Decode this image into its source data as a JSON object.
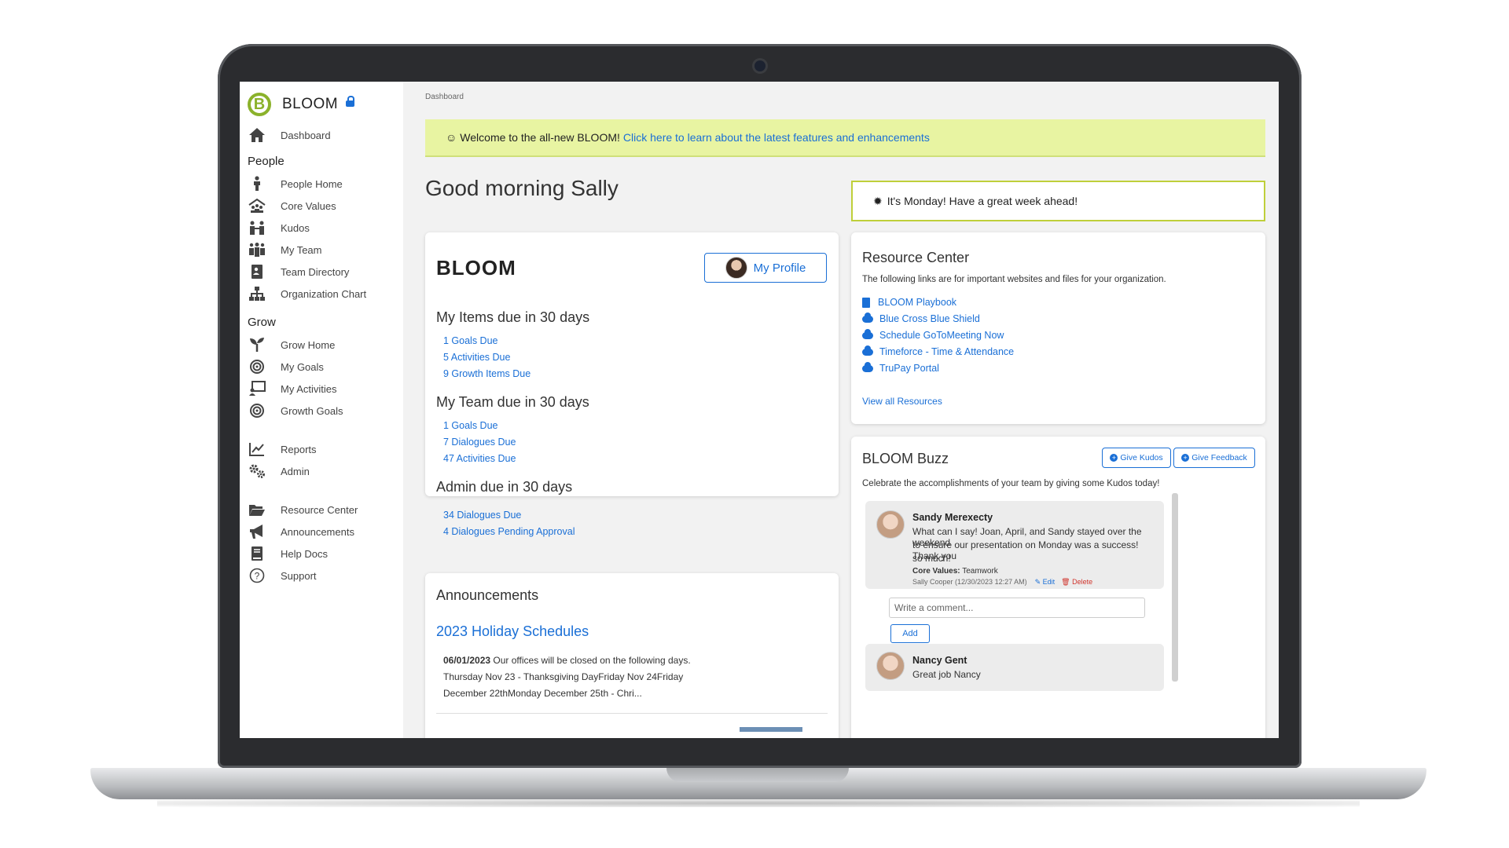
{
  "sidebar": {
    "brand": "BLOOM",
    "brand_logo_letter": "B",
    "dashboard": "Dashboard",
    "sections": {
      "people": "People",
      "grow": "Grow"
    },
    "people_items": [
      "People Home",
      "Core Values",
      "Kudos",
      "My Team",
      "Team Directory",
      "Organization Chart"
    ],
    "grow_items": [
      "Grow Home",
      "My Goals",
      "My Activities",
      "Growth Goals"
    ],
    "other_items": [
      "Reports",
      "Admin"
    ],
    "resource_items": [
      "Resource Center",
      "Announcements",
      "Help Docs",
      "Support"
    ]
  },
  "breadcrumb": "Dashboard",
  "banner": {
    "text": "Welcome to the all-new BLOOM!",
    "link": "Click here to learn about the latest features and enhancements"
  },
  "greeting": "Good morning Sally",
  "monday_message": "It's Monday! Have a great week ahead!",
  "summary_card": {
    "logo_text": "BLOOM",
    "profile_button": "My Profile",
    "my_items_title": "My Items due in 30 days",
    "my_items": [
      "1 Goals Due",
      "5 Activities Due",
      "9 Growth Items Due"
    ],
    "team_title": "My Team due in 30 days",
    "team_items": [
      "1 Goals Due",
      "7 Dialogues Due",
      "47 Activities Due"
    ],
    "admin_title": "Admin due in 30 days",
    "admin_items": [
      "34 Dialogues Due",
      "4 Dialogues Pending Approval"
    ]
  },
  "announcements": {
    "title": "Announcements",
    "headline": "2023 Holiday Schedules",
    "date": "06/01/2023",
    "line1": "Our offices will be closed on the following days.",
    "line2": "Thursday Nov 23 - Thanksgiving DayFriday Nov 24Friday",
    "line3": "December 22thMonday December 25th - Chri..."
  },
  "resource_center": {
    "title": "Resource Center",
    "description": "The following links are for important websites and files for your organization.",
    "links": [
      "BLOOM Playbook",
      "Blue Cross Blue Shield",
      "Schedule GoToMeeting Now",
      "Timeforce - Time & Attendance",
      "TruPay Portal"
    ],
    "view_all": "View all Resources"
  },
  "buzz": {
    "title": "BLOOM Buzz",
    "give_kudos": "Give Kudos",
    "give_feedback": "Give Feedback",
    "description": "Celebrate the accomplishments of your team by giving some Kudos today!",
    "post1": {
      "author": "Sandy Merexecty",
      "line1": "What can I say! Joan, April, and Sandy stayed over the weekend",
      "line2": "to ensure our presentation on Monday was a success! Thank you",
      "line3": "so much!",
      "core_values_label": "Core Values:",
      "core_values": "Teamwork",
      "meta": "Sally Cooper (12/30/2023 12:27 AM)",
      "edit": "Edit",
      "delete": "Delete"
    },
    "comment_placeholder": "Write a comment...",
    "add_button": "Add",
    "post2": {
      "author": "Nancy Gent",
      "text": "Great job Nancy"
    }
  }
}
